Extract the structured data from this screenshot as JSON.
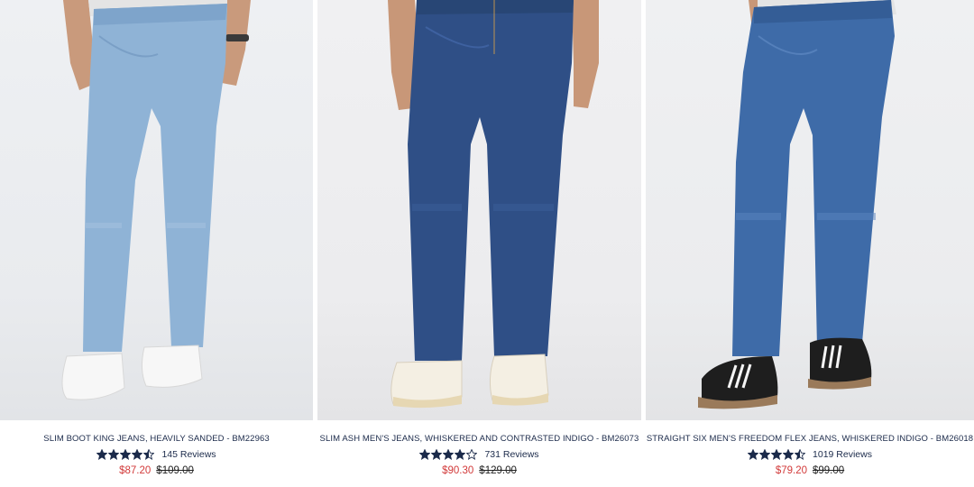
{
  "products": [
    {
      "title": "SLIM BOOT KING JEANS, HEAVILY SANDED - BM22963",
      "rating": 4.5,
      "reviews": "145 Reviews",
      "sale_price": "$87.20",
      "original_price": "$109.00",
      "denim_color": "#8fb3d6",
      "shoe": "white sneakers"
    },
    {
      "title": "SLIM ASH MEN'S JEANS, WHISKERED AND CONTRASTED INDIGO - BM26073",
      "rating": 4,
      "reviews": "731 Reviews",
      "sale_price": "$90.30",
      "original_price": "$129.00",
      "denim_color": "#2f4f86",
      "shoe": "cream sneakers"
    },
    {
      "title": "STRAIGHT SIX MEN'S FREEDOM FLEX JEANS, WHISKERED INDIGO - BM26018",
      "rating": 4.5,
      "reviews": "1019 Reviews",
      "sale_price": "$79.20",
      "original_price": "$99.00",
      "denim_color": "#3e6ba8",
      "shoe": "black three-stripe sneakers"
    }
  ],
  "colors": {
    "title_text": "#1b2a4a",
    "star_fill": "#1b2a4a",
    "sale_price": "#d23a3a"
  }
}
